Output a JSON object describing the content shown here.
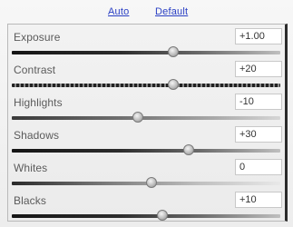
{
  "links": {
    "auto": "Auto",
    "default": "Default"
  },
  "sliders": [
    {
      "label": "Exposure",
      "value": "+1.00",
      "position": 0.6
    },
    {
      "label": "Contrast",
      "value": "+20",
      "position": 0.6
    },
    {
      "label": "Highlights",
      "value": "-10",
      "position": 0.47
    },
    {
      "label": "Shadows",
      "value": "+30",
      "position": 0.66
    },
    {
      "label": "Whites",
      "value": "0",
      "position": 0.52
    },
    {
      "label": "Blacks",
      "value": "+10",
      "position": 0.56
    }
  ]
}
